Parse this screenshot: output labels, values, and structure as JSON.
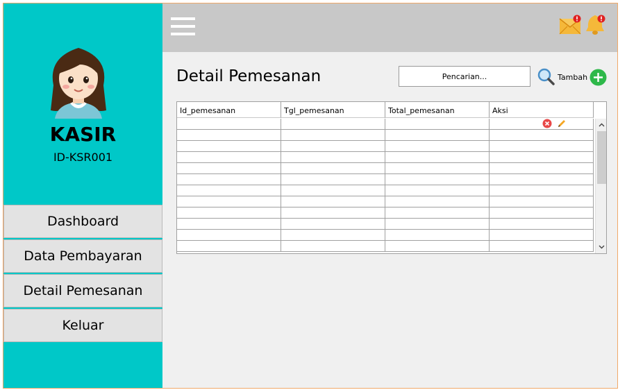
{
  "sidebar": {
    "role": "KASIR",
    "user_id": "ID-KSR001",
    "menu": [
      {
        "label": "Dashboard"
      },
      {
        "label": "Data Pembayaran"
      },
      {
        "label": "Detail Pemesanan"
      },
      {
        "label": "Keluar"
      }
    ]
  },
  "topbar": {
    "icons": [
      "menu-icon",
      "mail-icon",
      "bell-icon"
    ],
    "badge_color": "#e02020"
  },
  "main": {
    "title": "Detail Pemesanan",
    "search": {
      "placeholder": "Pencarian...",
      "value": ""
    },
    "add_label": "Tambah",
    "table": {
      "columns": [
        "Id_pemesanan",
        "Tgl_pemesanan",
        "Total_pemesanan",
        "Aksi"
      ],
      "rows": [
        [
          "",
          "",
          "",
          ""
        ],
        [
          "",
          "",
          "",
          ""
        ],
        [
          "",
          "",
          "",
          ""
        ],
        [
          "",
          "",
          "",
          ""
        ],
        [
          "",
          "",
          "",
          ""
        ],
        [
          "",
          "",
          "",
          ""
        ],
        [
          "",
          "",
          "",
          ""
        ],
        [
          "",
          "",
          "",
          ""
        ],
        [
          "",
          "",
          "",
          ""
        ],
        [
          "",
          "",
          "",
          ""
        ],
        [
          "",
          "",
          "",
          ""
        ],
        [
          "",
          "",
          "",
          ""
        ]
      ],
      "row_actions": [
        "delete-icon",
        "edit-icon"
      ]
    }
  },
  "colors": {
    "sidebar_bg": "#00c8c8",
    "topbar_bg": "#c8c8c8",
    "content_bg": "#f0f0f0",
    "add_button": "#2eb84a"
  }
}
